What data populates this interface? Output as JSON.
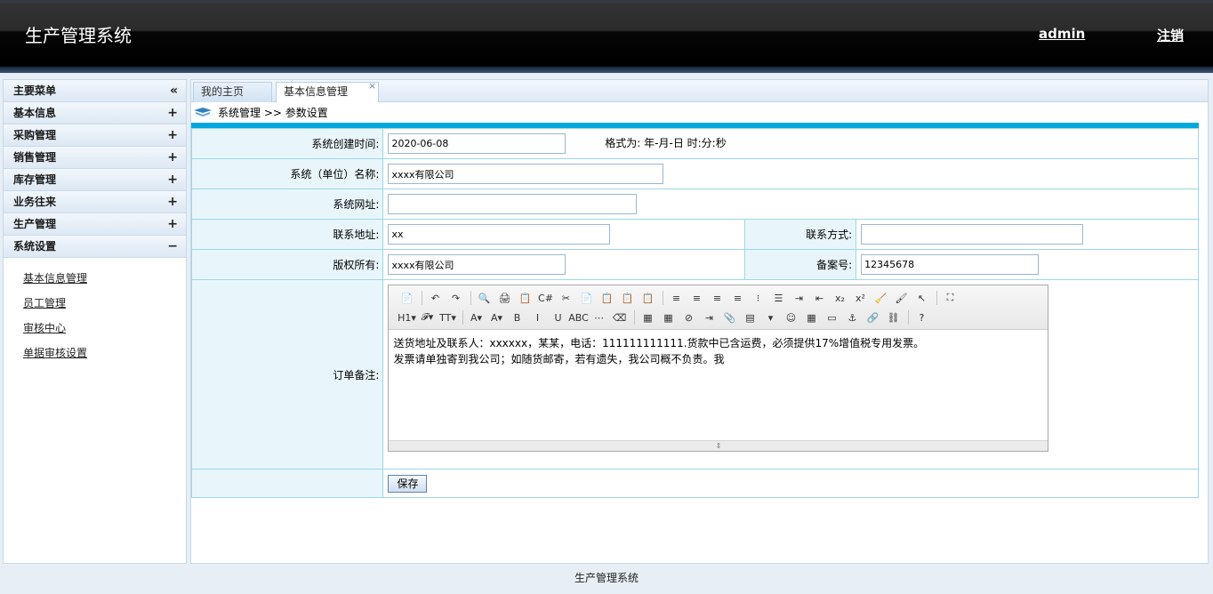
{
  "header": {
    "title": "生产管理系统",
    "user": "admin",
    "logout": "注销"
  },
  "sidebar": {
    "title": "主要菜单",
    "collapse_icon": "«",
    "groups": [
      {
        "label": "基本信息",
        "sign": "+"
      },
      {
        "label": "采购管理",
        "sign": "+"
      },
      {
        "label": "销售管理",
        "sign": "+"
      },
      {
        "label": "库存管理",
        "sign": "+"
      },
      {
        "label": "业务往来",
        "sign": "+"
      },
      {
        "label": "生产管理",
        "sign": "+"
      },
      {
        "label": "系统设置",
        "sign": "−"
      }
    ],
    "sub_items": [
      "基本信息管理",
      "员工管理",
      "审核中心",
      "单据审核设置"
    ]
  },
  "tabs": {
    "home": "我的主页",
    "basic": "基本信息管理",
    "close": "×"
  },
  "breadcrumb": "系统管理 >> 参数设置",
  "form": {
    "create_time_label": "系统创建时间:",
    "create_time_value": "2020-06-08",
    "format_hint": "格式为: 年-月-日 时:分:秒",
    "unit_name_label": "系统（单位）名称:",
    "unit_name_value": "xxxx有限公司",
    "website_label": "系统网址:",
    "website_value": "",
    "address_label": "联系地址:",
    "address_value": "xx",
    "contact_label": "联系方式:",
    "contact_value": "",
    "copyright_label": "版权所有:",
    "copyright_value": "xxxx有限公司",
    "record_label": "备案号:",
    "record_value": "12345678",
    "remark_label": "订单备注:",
    "remark_line1": "送货地址及联系人：xxxxxx，某某，电话：111111111111.货款中已含运费，必须提供17%增值税专用发票。",
    "remark_line2": "发票请单独寄到我公司；如随货邮寄，若有遗失，我公司概不负责。我",
    "save_label": "保存"
  },
  "editor": {
    "row1": [
      "📄",
      "↶",
      "↷",
      "🔍",
      "🖨",
      "📋",
      "C#",
      "✂",
      "📄",
      "📋",
      "📋",
      "📋",
      "≡",
      "≡",
      "≡",
      "≡",
      "⁝",
      "☰",
      "⇥",
      "⇤",
      "x₂",
      "x²",
      "🧹",
      "🖌",
      "↖",
      "⛶"
    ],
    "row2": [
      "H1▾",
      "𝓕▾",
      "TT▾",
      "A▾",
      "A▾",
      "B",
      "I",
      "U",
      "ABC",
      "⋯",
      "⌫",
      "▦",
      "▦",
      "⊘",
      "⇥",
      "📎",
      "▤",
      "▾",
      "☺",
      "▦",
      "▭",
      "⚓",
      "🔗",
      "⛓",
      "?"
    ],
    "resize_glyph": "⇕"
  },
  "footer": "生产管理系统"
}
